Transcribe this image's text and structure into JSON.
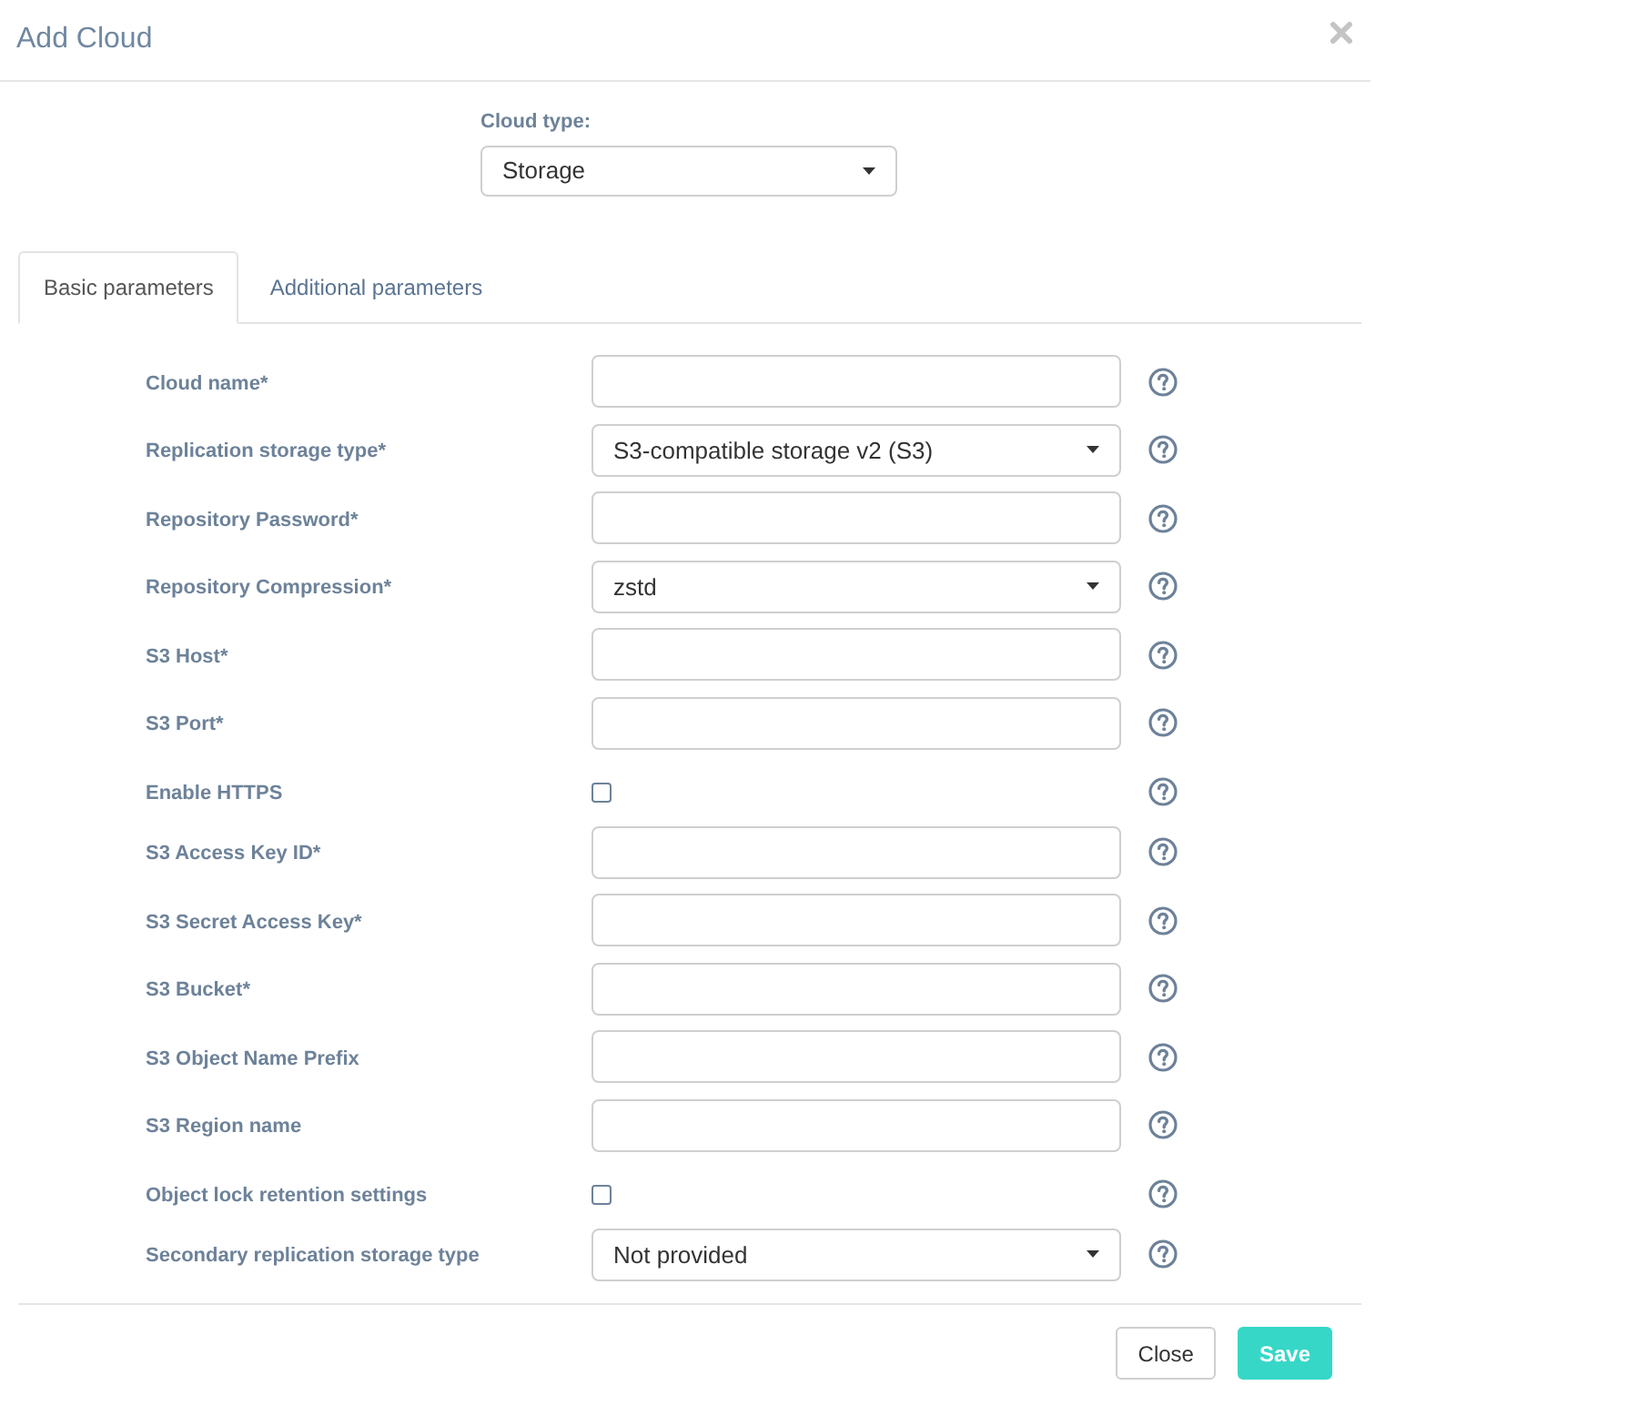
{
  "dialog": {
    "title": "Add Cloud"
  },
  "cloud_type": {
    "label": "Cloud type:",
    "value": "Storage"
  },
  "tabs": [
    {
      "label": "Basic parameters",
      "selected": true
    },
    {
      "label": "Additional parameters",
      "selected": false
    }
  ],
  "fields": [
    {
      "label": "Cloud name*",
      "kind": "text"
    },
    {
      "label": "Replication storage type*",
      "kind": "select",
      "value": "S3-compatible storage v2 (S3)"
    },
    {
      "label": "Repository Password*",
      "kind": "text"
    },
    {
      "label": "Repository Compression*",
      "kind": "select",
      "value": "zstd"
    },
    {
      "label": "S3 Host*",
      "kind": "text"
    },
    {
      "label": "S3 Port*",
      "kind": "text"
    },
    {
      "label": "Enable HTTPS",
      "kind": "checkbox",
      "checked": false
    },
    {
      "label": "S3 Access Key ID*",
      "kind": "text"
    },
    {
      "label": "S3 Secret Access Key*",
      "kind": "text"
    },
    {
      "label": "S3 Bucket*",
      "kind": "text"
    },
    {
      "label": "S3 Object Name Prefix",
      "kind": "text"
    },
    {
      "label": "S3 Region name",
      "kind": "text"
    },
    {
      "label": "Object lock retention settings",
      "kind": "checkbox",
      "checked": false
    },
    {
      "label": "Secondary replication storage type",
      "kind": "select",
      "value": "Not provided"
    }
  ],
  "buttons": [
    {
      "label": "Close",
      "kind": "secondary"
    },
    {
      "label": "Save",
      "kind": "primary"
    }
  ]
}
